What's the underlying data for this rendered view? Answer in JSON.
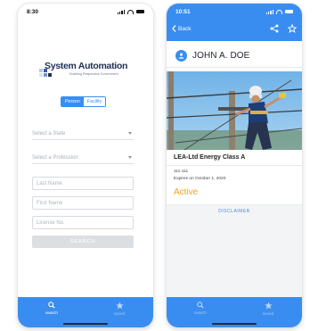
{
  "left": {
    "time": "8:30",
    "logo": {
      "title": "System Automation",
      "tagline": "Enabling Responsive Government"
    },
    "segments": {
      "person": "Person",
      "facility": "Facility"
    },
    "select_state": "Select a State",
    "select_profession": "Select a Profession",
    "last_name_placeholder": "Last Name",
    "first_name_placeholder": "First Name",
    "license_placeholder": "License No.",
    "search_button": "SEARCH",
    "tabs": {
      "search": "search",
      "saved": "saved"
    }
  },
  "right": {
    "time": "10:51",
    "back_label": "Back",
    "person_name": "JOHN A. DOE",
    "license_title": "LEA-Ltd Energy Class A",
    "license_number": "111-111",
    "expires": "Expires on October 1, 2020",
    "status": "Active",
    "disclaimer": "DISCLAIMER",
    "tabs": {
      "search": "search",
      "saved": "saved"
    }
  },
  "colors": {
    "accent": "#3a8df0",
    "status_active": "#f0a224",
    "logo_navy": "#1f2f55"
  }
}
